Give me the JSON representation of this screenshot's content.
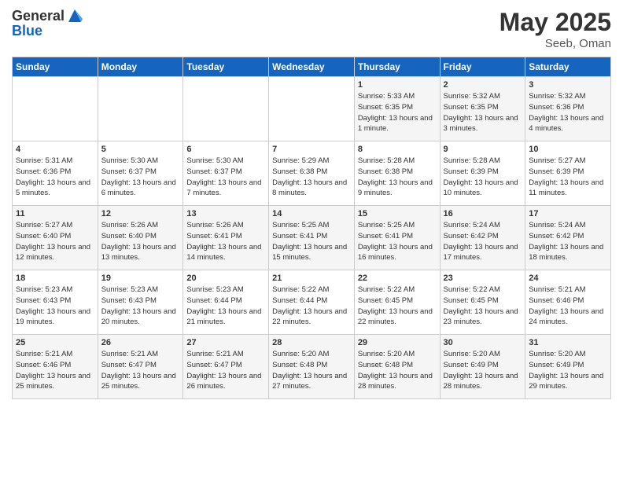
{
  "logo": {
    "general": "General",
    "blue": "Blue"
  },
  "title": "May 2025",
  "location": "Seeb, Oman",
  "days_of_week": [
    "Sunday",
    "Monday",
    "Tuesday",
    "Wednesday",
    "Thursday",
    "Friday",
    "Saturday"
  ],
  "weeks": [
    [
      {
        "num": "",
        "info": ""
      },
      {
        "num": "",
        "info": ""
      },
      {
        "num": "",
        "info": ""
      },
      {
        "num": "",
        "info": ""
      },
      {
        "num": "1",
        "info": "Sunrise: 5:33 AM\nSunset: 6:35 PM\nDaylight: 13 hours and 1 minute."
      },
      {
        "num": "2",
        "info": "Sunrise: 5:32 AM\nSunset: 6:35 PM\nDaylight: 13 hours and 3 minutes."
      },
      {
        "num": "3",
        "info": "Sunrise: 5:32 AM\nSunset: 6:36 PM\nDaylight: 13 hours and 4 minutes."
      }
    ],
    [
      {
        "num": "4",
        "info": "Sunrise: 5:31 AM\nSunset: 6:36 PM\nDaylight: 13 hours and 5 minutes."
      },
      {
        "num": "5",
        "info": "Sunrise: 5:30 AM\nSunset: 6:37 PM\nDaylight: 13 hours and 6 minutes."
      },
      {
        "num": "6",
        "info": "Sunrise: 5:30 AM\nSunset: 6:37 PM\nDaylight: 13 hours and 7 minutes."
      },
      {
        "num": "7",
        "info": "Sunrise: 5:29 AM\nSunset: 6:38 PM\nDaylight: 13 hours and 8 minutes."
      },
      {
        "num": "8",
        "info": "Sunrise: 5:28 AM\nSunset: 6:38 PM\nDaylight: 13 hours and 9 minutes."
      },
      {
        "num": "9",
        "info": "Sunrise: 5:28 AM\nSunset: 6:39 PM\nDaylight: 13 hours and 10 minutes."
      },
      {
        "num": "10",
        "info": "Sunrise: 5:27 AM\nSunset: 6:39 PM\nDaylight: 13 hours and 11 minutes."
      }
    ],
    [
      {
        "num": "11",
        "info": "Sunrise: 5:27 AM\nSunset: 6:40 PM\nDaylight: 13 hours and 12 minutes."
      },
      {
        "num": "12",
        "info": "Sunrise: 5:26 AM\nSunset: 6:40 PM\nDaylight: 13 hours and 13 minutes."
      },
      {
        "num": "13",
        "info": "Sunrise: 5:26 AM\nSunset: 6:41 PM\nDaylight: 13 hours and 14 minutes."
      },
      {
        "num": "14",
        "info": "Sunrise: 5:25 AM\nSunset: 6:41 PM\nDaylight: 13 hours and 15 minutes."
      },
      {
        "num": "15",
        "info": "Sunrise: 5:25 AM\nSunset: 6:41 PM\nDaylight: 13 hours and 16 minutes."
      },
      {
        "num": "16",
        "info": "Sunrise: 5:24 AM\nSunset: 6:42 PM\nDaylight: 13 hours and 17 minutes."
      },
      {
        "num": "17",
        "info": "Sunrise: 5:24 AM\nSunset: 6:42 PM\nDaylight: 13 hours and 18 minutes."
      }
    ],
    [
      {
        "num": "18",
        "info": "Sunrise: 5:23 AM\nSunset: 6:43 PM\nDaylight: 13 hours and 19 minutes."
      },
      {
        "num": "19",
        "info": "Sunrise: 5:23 AM\nSunset: 6:43 PM\nDaylight: 13 hours and 20 minutes."
      },
      {
        "num": "20",
        "info": "Sunrise: 5:23 AM\nSunset: 6:44 PM\nDaylight: 13 hours and 21 minutes."
      },
      {
        "num": "21",
        "info": "Sunrise: 5:22 AM\nSunset: 6:44 PM\nDaylight: 13 hours and 22 minutes."
      },
      {
        "num": "22",
        "info": "Sunrise: 5:22 AM\nSunset: 6:45 PM\nDaylight: 13 hours and 22 minutes."
      },
      {
        "num": "23",
        "info": "Sunrise: 5:22 AM\nSunset: 6:45 PM\nDaylight: 13 hours and 23 minutes."
      },
      {
        "num": "24",
        "info": "Sunrise: 5:21 AM\nSunset: 6:46 PM\nDaylight: 13 hours and 24 minutes."
      }
    ],
    [
      {
        "num": "25",
        "info": "Sunrise: 5:21 AM\nSunset: 6:46 PM\nDaylight: 13 hours and 25 minutes."
      },
      {
        "num": "26",
        "info": "Sunrise: 5:21 AM\nSunset: 6:47 PM\nDaylight: 13 hours and 25 minutes."
      },
      {
        "num": "27",
        "info": "Sunrise: 5:21 AM\nSunset: 6:47 PM\nDaylight: 13 hours and 26 minutes."
      },
      {
        "num": "28",
        "info": "Sunrise: 5:20 AM\nSunset: 6:48 PM\nDaylight: 13 hours and 27 minutes."
      },
      {
        "num": "29",
        "info": "Sunrise: 5:20 AM\nSunset: 6:48 PM\nDaylight: 13 hours and 28 minutes."
      },
      {
        "num": "30",
        "info": "Sunrise: 5:20 AM\nSunset: 6:49 PM\nDaylight: 13 hours and 28 minutes."
      },
      {
        "num": "31",
        "info": "Sunrise: 5:20 AM\nSunset: 6:49 PM\nDaylight: 13 hours and 29 minutes."
      }
    ]
  ]
}
